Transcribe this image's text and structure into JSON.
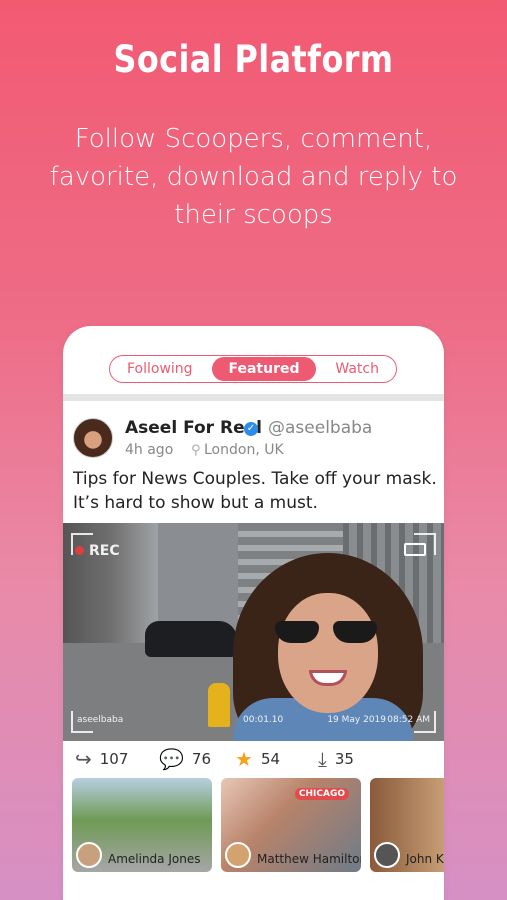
{
  "hero": {
    "title": "Social Platform",
    "subtitle": "Follow Scoopers, comment, favorite, download and reply to their scoops"
  },
  "tabs": [
    {
      "label": "Following",
      "active": false
    },
    {
      "label": "Featured",
      "active": true
    },
    {
      "label": "Watch",
      "active": false
    }
  ],
  "post": {
    "author_name": "Aseel For Real",
    "handle": "@aseelbaba",
    "verified": true,
    "time": "4h ago",
    "location": "London, UK",
    "text": "Tips for News Couples. Take off your mask. It’s hard to show but a must.",
    "video": {
      "rec_label": "REC",
      "timecode": "00:01.10",
      "watermark": "aseelbaba",
      "date": "19 May 2019",
      "clock": "08:52 AM"
    },
    "stats": {
      "reshares": "107",
      "comments": "76",
      "favorites": "54",
      "downloads": "35"
    }
  },
  "related": [
    {
      "name": "Amelinda Jones"
    },
    {
      "name": "Matthew Hamilton",
      "tag": "CHICAGO"
    },
    {
      "name": "John K"
    }
  ],
  "colors": {
    "accent": "#ee5a72",
    "verified": "#2d8ce8",
    "star": "#f4a21c"
  },
  "icons": {
    "verified": "check-badge-icon",
    "location": "pin-icon",
    "reshare": "share-arrow-icon",
    "comment": "comment-bubble-icon",
    "favorite": "star-icon",
    "download": "download-icon",
    "camera": "camera-icon"
  }
}
